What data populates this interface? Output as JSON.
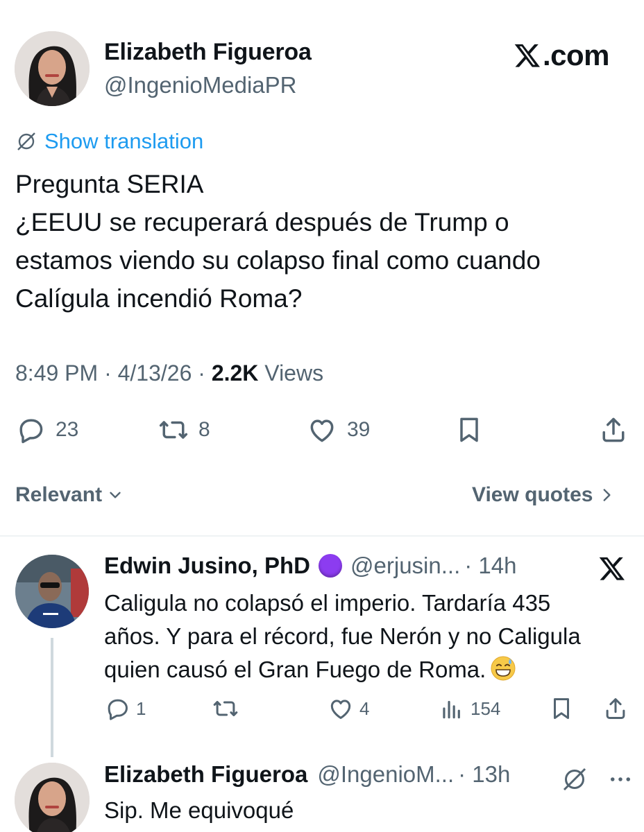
{
  "tweet": {
    "author_name": "Elizabeth Figueroa",
    "author_handle": "@IngenioMediaPR",
    "site_label": ".com",
    "translation_link": "Show translation",
    "body_lines": [
      "Pregunta SERIA",
      "¿EEUU se recuperará después de Trump o",
      "estamos viendo su colapso final como cuando",
      "Calígula incendió Roma?"
    ],
    "time": "8:49 PM",
    "date": "4/13/26",
    "views_count": "2.2K",
    "views_label": "Views",
    "separator": "·",
    "replies": "23",
    "reposts": "8",
    "likes": "39"
  },
  "sort": {
    "relevant_label": "Relevant",
    "view_quotes_label": "View quotes"
  },
  "replies": [
    {
      "name": "Edwin Jusino, PhD",
      "handle": "@erjusin...",
      "time": "· 14h",
      "body_lines": [
        "Caligula no colapsó el imperio. Tardaría 435",
        "años. Y para el récord, fue Nerón y no Caligula",
        "quien causó el Gran Fuego de Roma."
      ],
      "reply_count": "1",
      "repost_count": "",
      "like_count": "4",
      "view_count": "154"
    },
    {
      "name": "Elizabeth Figueroa",
      "handle": "@IngenioM...",
      "time": "· 13h",
      "body": "Sip. Me equivoqué"
    }
  ],
  "colors": {
    "link_blue": "#1d9bf0",
    "muted_gray": "#536471",
    "text": "#0f1419",
    "badge_purple": "#8c3cf0"
  },
  "icons": {
    "x_logo": "x-logo-icon",
    "translate": "globe-slash-icon",
    "reply": "speech-bubble-icon",
    "repost": "repost-arrows-icon",
    "like": "heart-icon",
    "bookmark": "bookmark-icon",
    "share": "share-upload-icon",
    "views": "bar-chart-icon",
    "more": "ellipsis-icon",
    "emoji": "grinning-sweat-emoji"
  }
}
